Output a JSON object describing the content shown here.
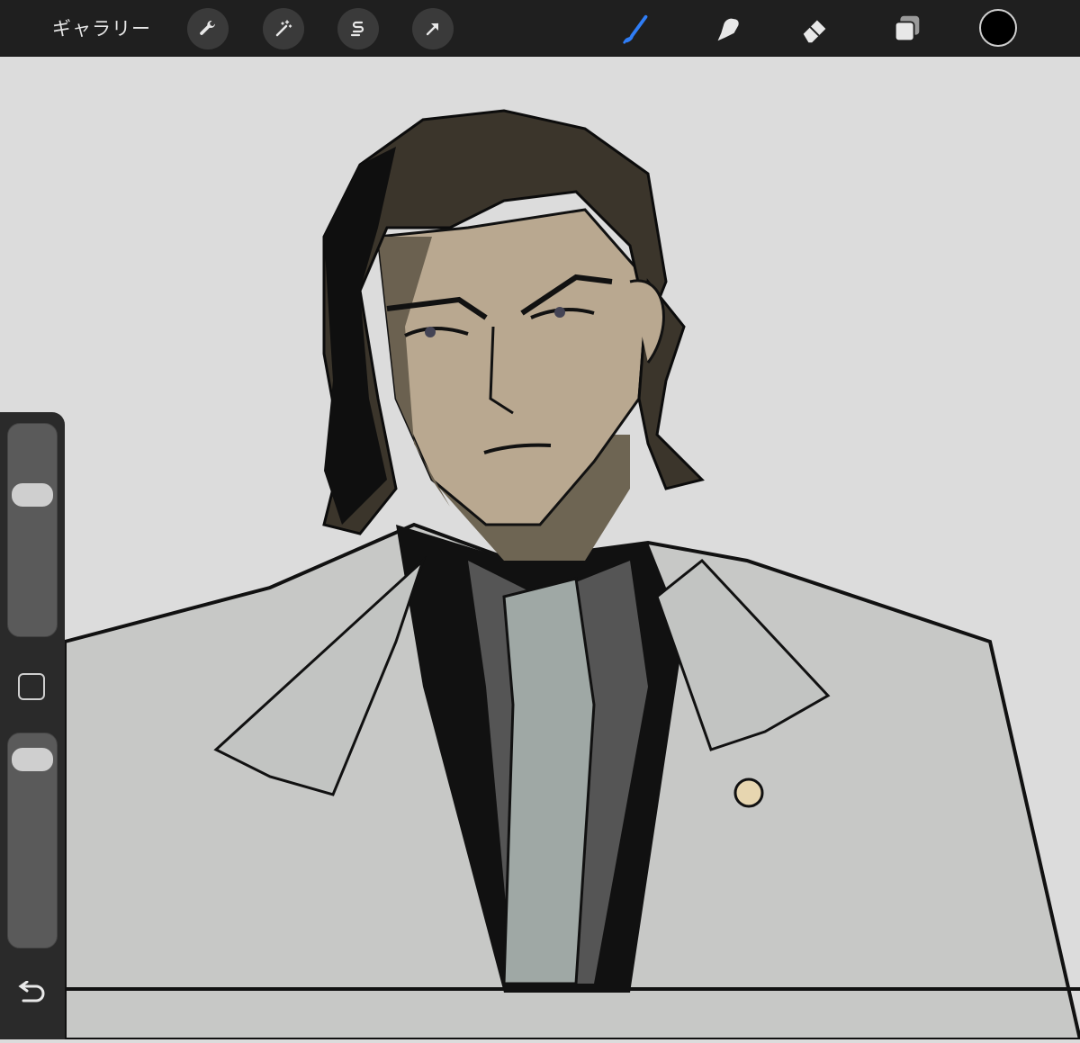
{
  "toolbar": {
    "gallery_label": "ギャラリー",
    "left_icons": [
      "wrench-icon",
      "magic-wand-icon",
      "selection-s-icon",
      "transform-arrow-icon"
    ],
    "right_icons": [
      "brush-icon",
      "smudge-icon",
      "eraser-icon",
      "layers-icon"
    ],
    "active_tool": "brush",
    "active_tool_color": "#2f7df6",
    "current_color": "#000000"
  },
  "sidebar": {
    "brush_size_level": 0.7,
    "brush_opacity_level": 0.95,
    "modifier_icon": "square-modifier-icon",
    "undo_icon": "undo-icon"
  },
  "canvas": {
    "background": "#dcdcdc"
  }
}
